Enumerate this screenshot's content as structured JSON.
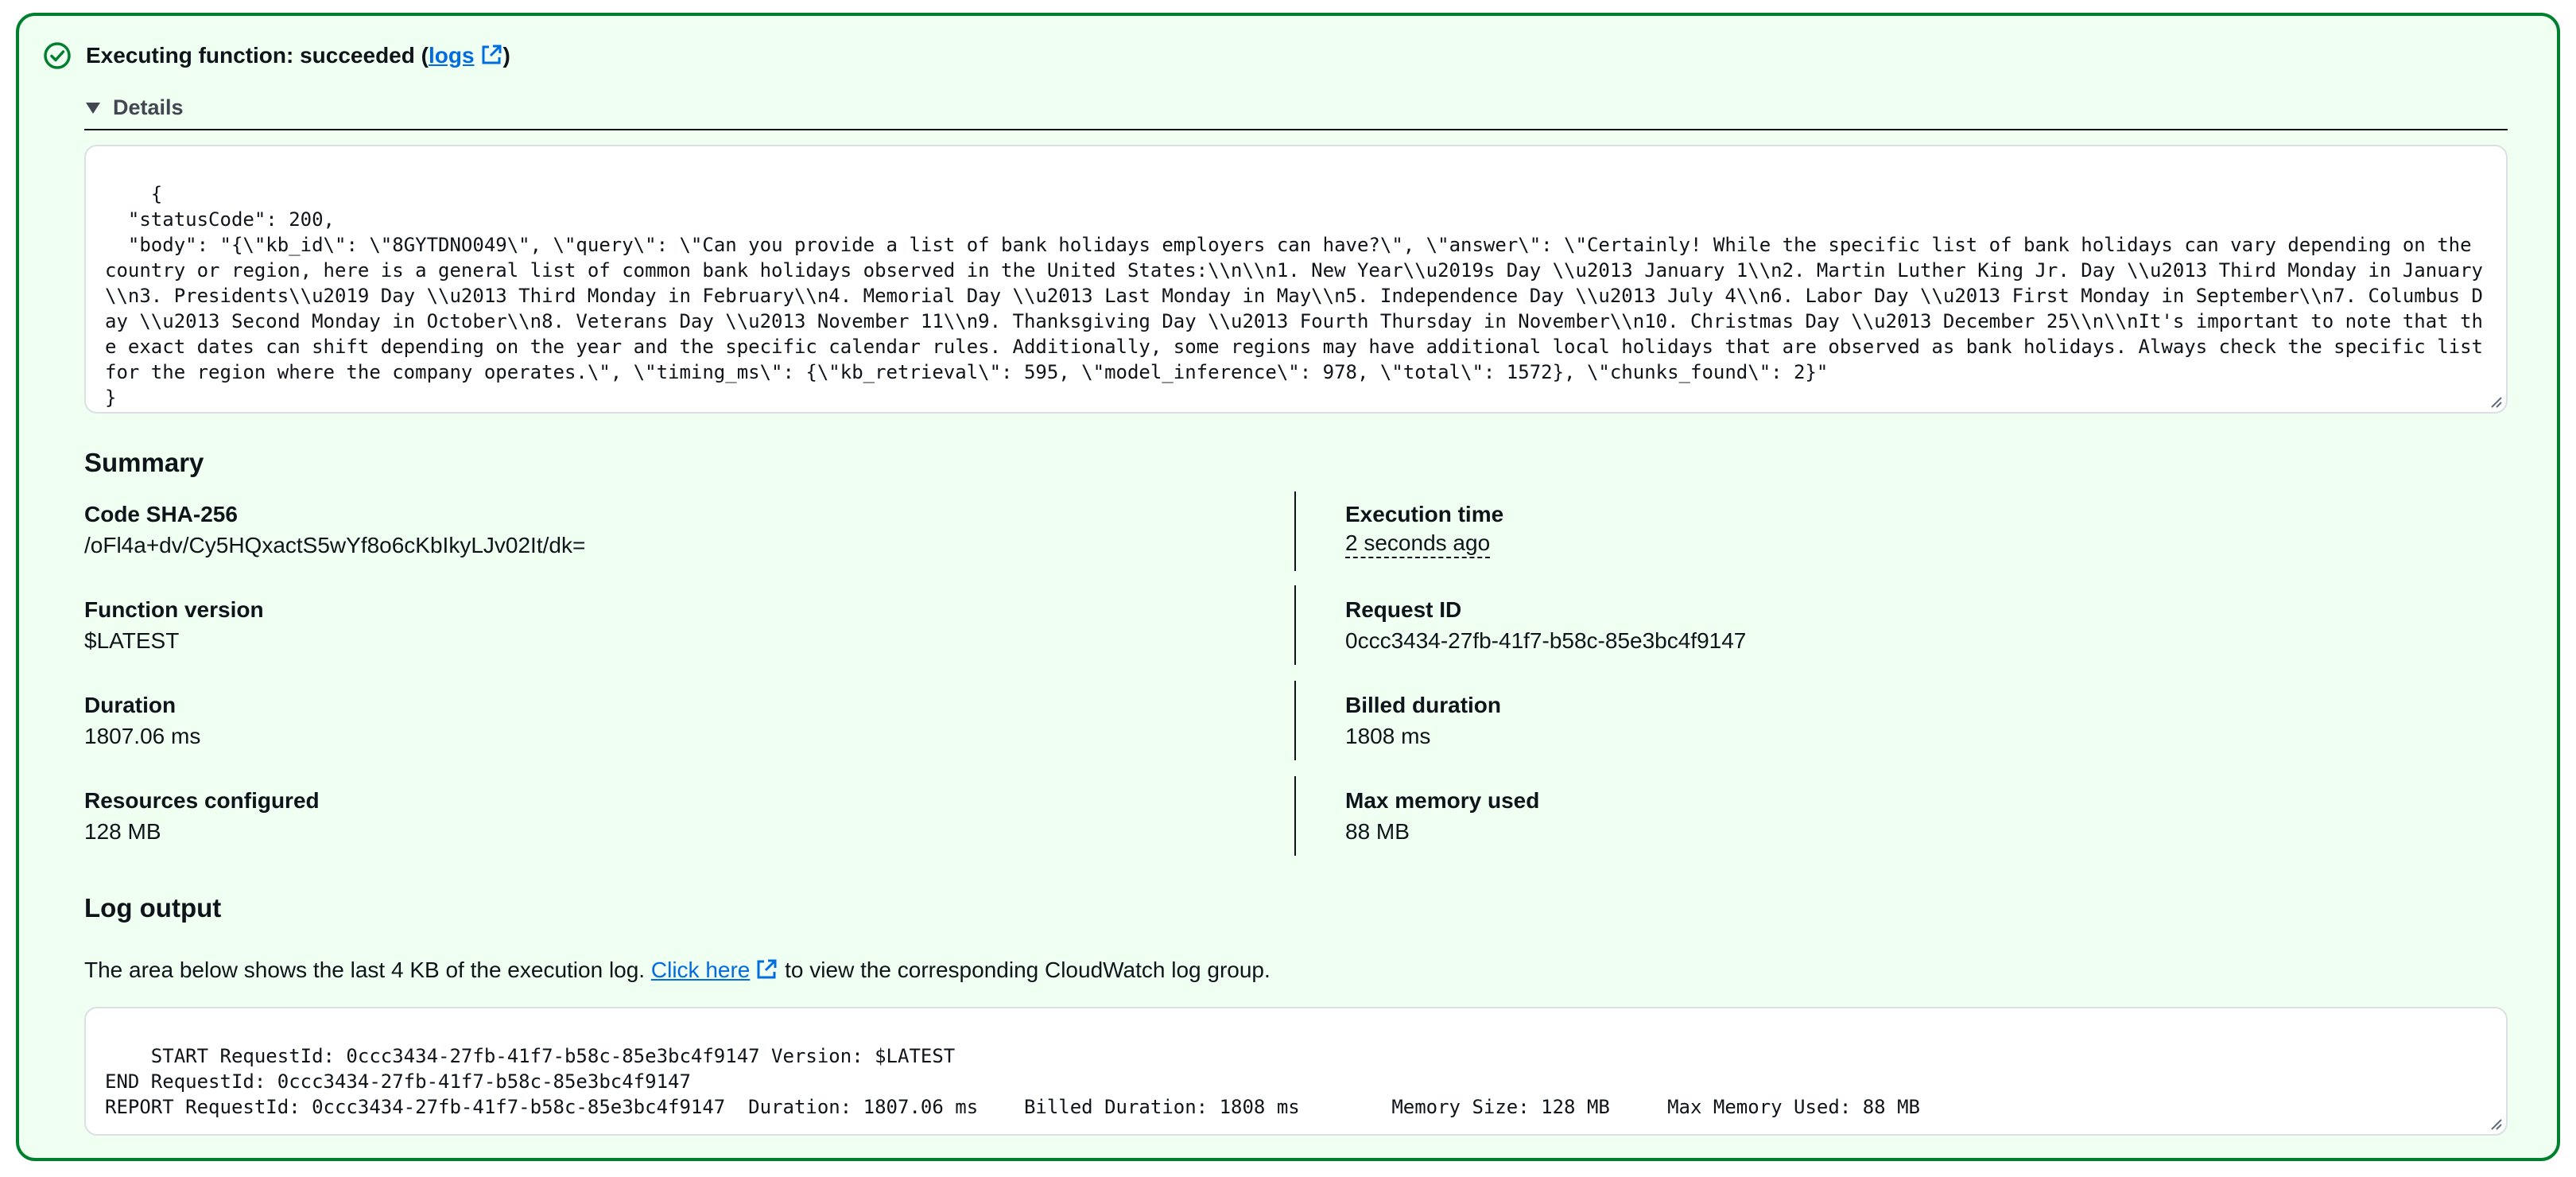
{
  "status": {
    "prefix": "Executing function: succeeded (",
    "logs_link": "logs",
    "suffix": ")"
  },
  "details": {
    "label": "Details",
    "response": "{\n  \"statusCode\": 200,\n  \"body\": \"{\\\"kb_id\\\": \\\"8GYTDNO049\\\", \\\"query\\\": \\\"Can you provide a list of bank holidays employers can have?\\\", \\\"answer\\\": \\\"Certainly! While the specific list of bank holidays can vary depending on the country or region, here is a general list of common bank holidays observed in the United States:\\\\n\\\\n1. New Year\\\\u2019s Day \\\\u2013 January 1\\\\n2. Martin Luther King Jr. Day \\\\u2013 Third Monday in January\\\\n3. Presidents\\\\u2019 Day \\\\u2013 Third Monday in February\\\\n4. Memorial Day \\\\u2013 Last Monday in May\\\\n5. Independence Day \\\\u2013 July 4\\\\n6. Labor Day \\\\u2013 First Monday in September\\\\n7. Columbus Day \\\\u2013 Second Monday in October\\\\n8. Veterans Day \\\\u2013 November 11\\\\n9. Thanksgiving Day \\\\u2013 Fourth Thursday in November\\\\n10. Christmas Day \\\\u2013 December 25\\\\n\\\\nIt's important to note that the exact dates can shift depending on the year and the specific calendar rules. Additionally, some regions may have additional local holidays that are observed as bank holidays. Always check the specific list for the region where the company operates.\\\", \\\"timing_ms\\\": {\\\"kb_retrieval\\\": 595, \\\"model_inference\\\": 978, \\\"total\\\": 1572}, \\\"chunks_found\\\": 2}\"\n}"
  },
  "summary": {
    "title": "Summary",
    "code_sha_label": "Code SHA-256",
    "code_sha_value": "/oFl4a+dv/Cy5HQxactS5wYf8o6cKbIkyLJv02It/dk=",
    "execution_time_label": "Execution time",
    "execution_time_value": "2 seconds ago",
    "function_version_label": "Function version",
    "function_version_value": "$LATEST",
    "request_id_label": "Request ID",
    "request_id_value": "0ccc3434-27fb-41f7-b58c-85e3bc4f9147",
    "duration_label": "Duration",
    "duration_value": "1807.06 ms",
    "billed_duration_label": "Billed duration",
    "billed_duration_value": "1808 ms",
    "resources_label": "Resources configured",
    "resources_value": "128 MB",
    "max_memory_label": "Max memory used",
    "max_memory_value": "88 MB"
  },
  "log_output": {
    "title": "Log output",
    "desc_prefix": "The area below shows the last 4 KB of the execution log. ",
    "click_here": "Click here",
    "desc_suffix": " to view the corresponding CloudWatch log group.",
    "log_text": "START RequestId: 0ccc3434-27fb-41f7-b58c-85e3bc4f9147 Version: $LATEST\nEND RequestId: 0ccc3434-27fb-41f7-b58c-85e3bc4f9147\nREPORT RequestId: 0ccc3434-27fb-41f7-b58c-85e3bc4f9147  Duration: 1807.06 ms    Billed Duration: 1808 ms        Memory Size: 128 MB     Max Memory Used: 88 MB"
  },
  "colors": {
    "success": "#00802f",
    "panel_bg": "#effff1",
    "link": "#006ce0"
  },
  "icons": {
    "status": "success-check-circle-icon",
    "external": "external-link-icon",
    "expand": "caret-down-icon"
  }
}
